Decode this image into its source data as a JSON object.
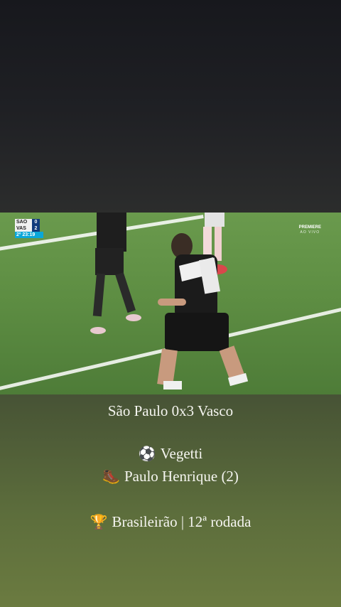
{
  "scoreboard": {
    "home_team": "SAO",
    "home_score": "0",
    "away_team": "VAS",
    "away_score": "2",
    "clock": "2º 23:19"
  },
  "broadcaster": {
    "name": "PREMIERE",
    "status": "AO VIVO"
  },
  "caption": {
    "result": "São Paulo 0x3 Vasco",
    "scorer_icon": "⚽",
    "scorer": "Vegetti",
    "assist_icon": "🥾",
    "assist": "Paulo Henrique (2)",
    "competition_icon": "🏆",
    "competition": "Brasileirão | 12ª rodada"
  },
  "colors": {
    "pitch": "#5e8e43",
    "score_blue": "#123b7c",
    "clock_cyan": "#0aa7d8"
  }
}
